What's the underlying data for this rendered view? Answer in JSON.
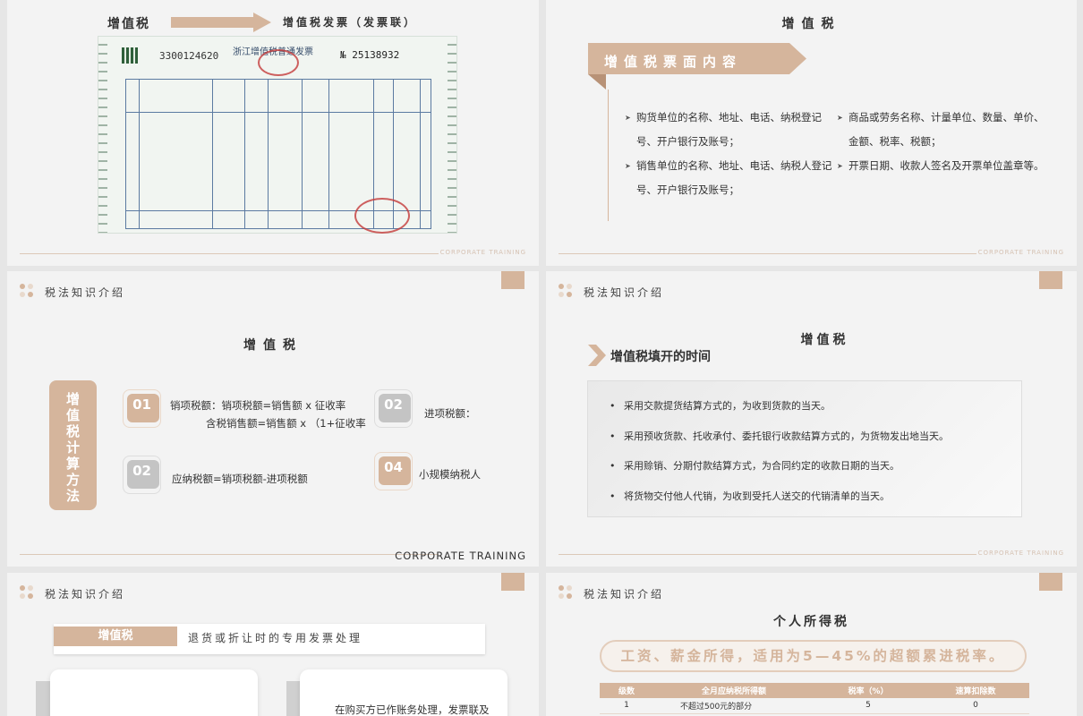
{
  "footer_text": "CORPORATE TRAINING",
  "section_header": "税法知识介绍",
  "accent_color": "#d5b59c",
  "slide1": {
    "title": "增值税",
    "subtitle": "增值税发票（发票联）",
    "invoice": {
      "heading": "浙江增值税普通发票",
      "code": "3300124620",
      "number": "№ 25138932"
    }
  },
  "slide2": {
    "title": "增值税",
    "banner": "增值税票面内容",
    "left_items": [
      "购货单位的名称、地址、电话、纳税登记号、开户银行及账号；",
      "销售单位的名称、地址、电话、纳税人登记号、开户银行及账号；"
    ],
    "right_items": [
      "商品或劳务名称、计量单位、数量、单价、金额、税率、税额；",
      "开票日期、收款人签名及开票单位盖章等。"
    ]
  },
  "slide3": {
    "title": "增值税",
    "vertical_label": "增值税计算方法",
    "items": [
      {
        "num": "01",
        "line1": "销项税额：销项税额=销售额 x 征收率",
        "line2": "含税销售额=销售额 x （1+征收率"
      },
      {
        "num": "02",
        "line1": "进项税额："
      },
      {
        "num": "02",
        "line1": "应纳税额=销项税额-进项税额"
      },
      {
        "num": "04",
        "line1": "小规模纳税人"
      }
    ]
  },
  "slide4": {
    "title": "增值税",
    "heading": "增值税填开的时间",
    "items": [
      "采用交款提货结算方式的，为收到货款的当天。",
      "采用预收货款、托收承付、委托银行收款结算方式的，为货物发出地当天。",
      "采用赊销、分期付款结算方式，为合同约定的收款日期的当天。",
      "将货物交付他人代销，为收到受托人送交的代销清单的当天。"
    ]
  },
  "slide5": {
    "tag": "增值税",
    "bar_text": "退货或折让时的专用发票处理",
    "card_text": "在购买方已作账务处理，发票联及"
  },
  "slide6": {
    "title": "个人所得税",
    "pill": "工资、薪金所得，适用为5—45%的超额累进税率。",
    "table": {
      "headers": [
        "级数",
        "全月应纳税所得额",
        "税率（%）",
        "速算扣除数"
      ],
      "rows": [
        [
          "1",
          "不超过500元的部分",
          "5",
          "0"
        ]
      ]
    }
  }
}
